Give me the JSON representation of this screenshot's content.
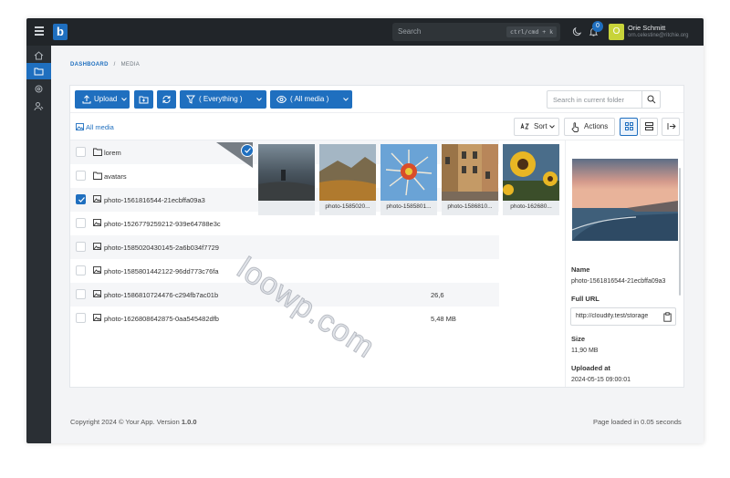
{
  "app": {
    "logo_letter": "b",
    "brand_color": "#1f6fbf"
  },
  "topbar": {
    "search_placeholder": "Search",
    "search_shortcut": "ctrl/cmd + k",
    "notifications_count": "0",
    "avatar_letter": "O",
    "user_name": "Orie Schmitt",
    "user_email": "orn.celestine@ritchie.org"
  },
  "sidebar": {
    "items": [
      {
        "icon": "home-icon"
      },
      {
        "icon": "folder-icon",
        "active": true
      },
      {
        "icon": "gear-icon"
      },
      {
        "icon": "users-icon"
      }
    ]
  },
  "breadcrumb": {
    "first": "DASHBOARD",
    "sep": "/",
    "current": "MEDIA"
  },
  "toolbar": {
    "upload_label": "Upload",
    "filter_label": "( Everything )",
    "view_label": "( All media )",
    "search_placeholder": "Search in current folder",
    "all_media_label": "All media",
    "sort_label": "Sort",
    "actions_label": "Actions"
  },
  "rows": [
    {
      "name": "lorem",
      "type": "folder",
      "size": "",
      "checked": false
    },
    {
      "name": "avatars",
      "type": "folder",
      "size": "",
      "checked": false
    },
    {
      "name": "photo-1561816544-21ecbffa09a3",
      "type": "image",
      "size": "",
      "checked": true
    },
    {
      "name": "photo-1526779259212-939e64788e3c",
      "type": "image",
      "size": "",
      "checked": false
    },
    {
      "name": "photo-1585020430145-2a6b034f7729",
      "type": "image",
      "size": "",
      "checked": false
    },
    {
      "name": "photo-1585801442122-96dd773c76fa",
      "type": "image",
      "size": "",
      "checked": false
    },
    {
      "name": "photo-1586810724476-c294fb7ac01b",
      "type": "image",
      "size": "26,6",
      "checked": false
    },
    {
      "name": "photo-1626808642875-0aa545482dfb",
      "type": "image",
      "size": "5,48 MB",
      "checked": false
    }
  ],
  "thumbnails": [
    {
      "caption": ""
    },
    {
      "caption": "photo-1585020..."
    },
    {
      "caption": "photo-1585801..."
    },
    {
      "caption": "photo-1586810..."
    },
    {
      "caption": "photo-162680..."
    }
  ],
  "details": {
    "name_label": "Name",
    "name_value": "photo-1561816544-21ecbffa09a3",
    "url_label": "Full URL",
    "url_value": "http://cloudify.test/storage",
    "size_label": "Size",
    "size_value": "11,90 MB",
    "uploaded_label": "Uploaded at",
    "uploaded_value": "2024-05-15 09:00:01"
  },
  "footer": {
    "copyright": "Copyright 2024 © Your App. Version",
    "version": "1.0.0",
    "load_time": "Page loaded in 0.05 seconds"
  },
  "watermark": "loowp.com"
}
